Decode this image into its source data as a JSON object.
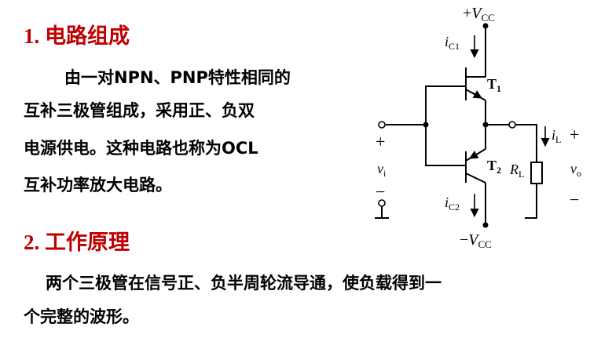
{
  "section1": {
    "heading": "1.  电路组成",
    "lines": [
      "由一对NPN、PNP特性相同的",
      "互补三极管组成，采用正、负双",
      "电源供电。这种电路也称为OCL",
      "互补功率放大电路。"
    ]
  },
  "section2": {
    "heading": "2.  工作原理",
    "lines": [
      "两个三极管在信号正、负半周轮流导通，使负载得到一",
      "个完整的波形。"
    ]
  },
  "circuit": {
    "vcc_sign": "+",
    "vcc_v": "V",
    "vcc_sub": "CC",
    "vee_sign": "−",
    "vee_v": "V",
    "vee_sub": "CC",
    "ic1_i": "i",
    "ic1_sub": "C1",
    "ic2_i": "i",
    "ic2_sub": "C2",
    "t1": "T",
    "t1_sub": "1",
    "t2": "T",
    "t2_sub": "2",
    "il_i": "i",
    "il_sub": "L",
    "rl_r": "R",
    "rl_sub": "L",
    "vi_v": "v",
    "vi_sub": "i",
    "vo_v": "v",
    "vo_sub": "o",
    "in_plus": "+",
    "in_minus": "−",
    "out_plus": "+",
    "out_minus": "−"
  }
}
